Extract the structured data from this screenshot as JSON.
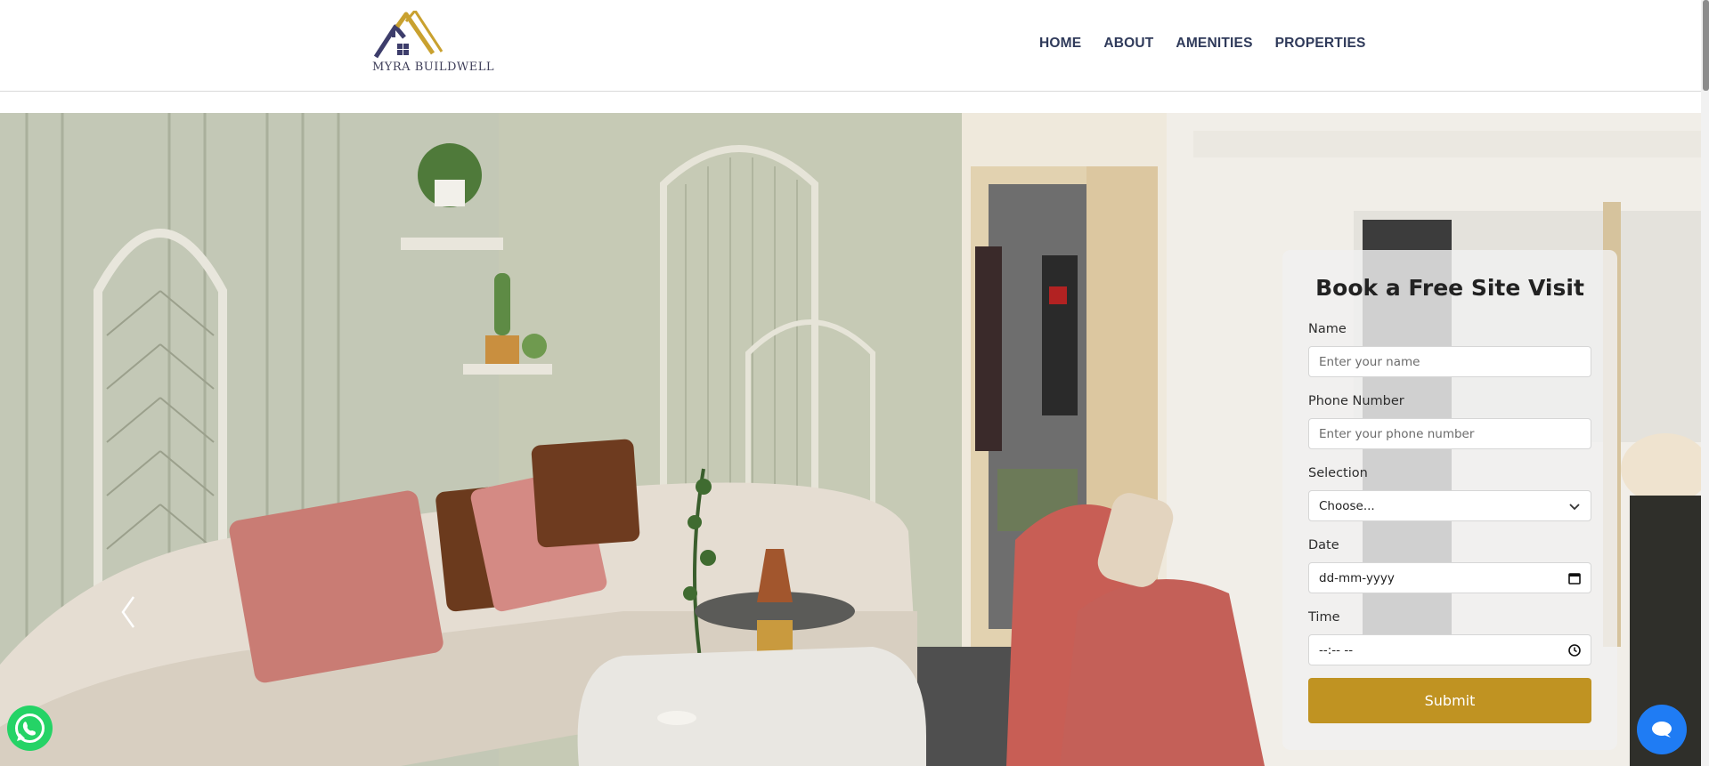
{
  "header": {
    "logo_text": "MYRA BUILDWELL",
    "nav": [
      "HOME",
      "ABOUT",
      "AMENITIES",
      "PROPERTIES"
    ]
  },
  "form": {
    "title": "Book a Free Site Visit",
    "name_label": "Name",
    "name_placeholder": "Enter your name",
    "phone_label": "Phone Number",
    "phone_placeholder": "Enter your phone number",
    "selection_label": "Selection",
    "selection_value": "Choose...",
    "date_label": "Date",
    "date_placeholder": "dd-mm-yyyy",
    "time_label": "Time",
    "time_placeholder": "--:-- --",
    "submit_label": "Submit"
  },
  "colors": {
    "accent": "#c09322",
    "nav_text": "#2f3a5a",
    "whatsapp": "#25d366",
    "chat": "#1f7cf4"
  },
  "icons": [
    "house-logo-icon",
    "chevron-left-icon",
    "chevron-down-icon",
    "calendar-icon",
    "clock-icon",
    "whatsapp-icon",
    "chat-icon"
  ]
}
